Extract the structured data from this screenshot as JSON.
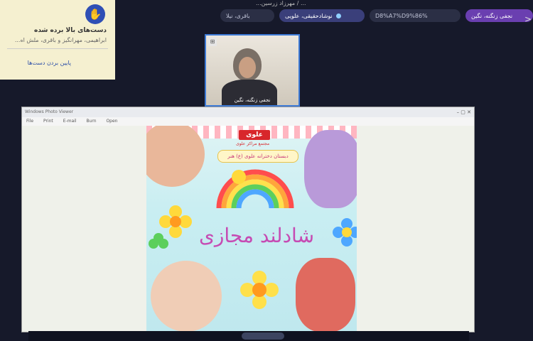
{
  "topbar": {
    "title": "...مهرزاد زرسین / ...",
    "participants": [
      {
        "label": "نجفی زنگنه، نگین",
        "style": "purple"
      },
      {
        "label": "D8%A7%D9%86%",
        "style": "dim"
      },
      {
        "label": "نوشادحقیقی، علویی",
        "style": "blue"
      },
      {
        "label": "باقری، نیلا",
        "style": "dim"
      }
    ],
    "edge_arrow": ">"
  },
  "raised_hands": {
    "title": "دست‌های بالا برده شده",
    "names": "ابراهیمی، مهرانگیز و باقری، ملش اه...",
    "lower_all": "پایین بردن دست‌ها"
  },
  "camera": {
    "name": "نجفی زنگنه، نگین"
  },
  "shared_window": {
    "title": "Windows Photo Viewer",
    "menu": [
      "File",
      "Print",
      "E-mail",
      "Burn",
      "Open"
    ],
    "poster": {
      "brand": "علوی",
      "brand_sub": "مجتمع مراکز علوی",
      "ribbon": "دبستان دخترانه علوی (ع) هنر",
      "headline": "شادلند مجازی"
    }
  },
  "colors": {
    "background": "#16192a",
    "accent_blue": "#2f4fb5",
    "accent_purple": "#6a3fb0",
    "headline": "#c64bb3"
  }
}
